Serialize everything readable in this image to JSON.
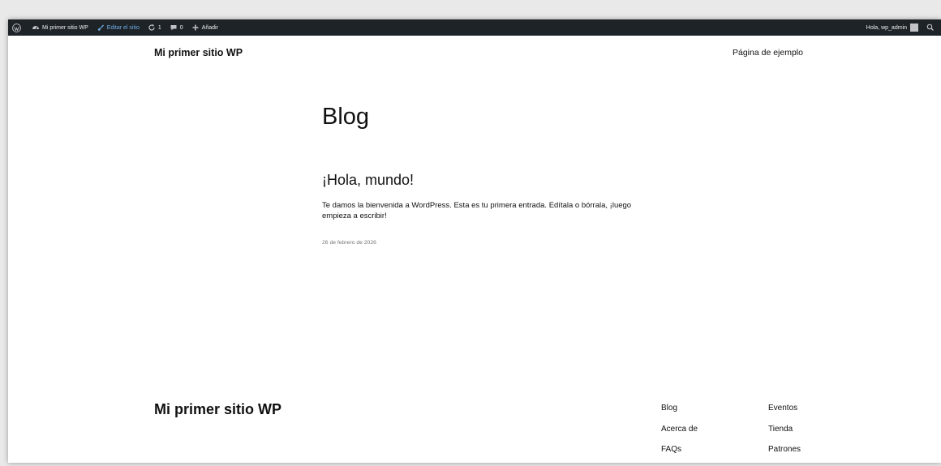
{
  "admin_bar": {
    "site_name": "Mi primer sitio WP",
    "edit_site": "Editar el sitio",
    "updates_count": "1",
    "comments_count": "0",
    "add_new": "Añadir",
    "greeting": "Hola, wp_admin"
  },
  "header": {
    "site_title": "Mi primer sitio WP",
    "nav_item": "Página de ejemplo"
  },
  "main": {
    "page_title": "Blog",
    "post": {
      "title": "¡Hola, mundo!",
      "excerpt": "Te damos la bienvenida a WordPress. Esta es tu primera entrada. Edítala o bórrala, ¡luego empieza a escribir!",
      "date": "26 de febrero de 2026"
    }
  },
  "footer": {
    "site_title": "Mi primer sitio WP",
    "links_col1": [
      "Blog",
      "Acerca de",
      "FAQs"
    ],
    "links_col2": [
      "Eventos",
      "Tienda",
      "Patrones"
    ]
  },
  "colors": {
    "admin_bar_bg": "#1d2327",
    "admin_bar_text": "#f0f0f1",
    "admin_bar_active": "#72aee6"
  }
}
